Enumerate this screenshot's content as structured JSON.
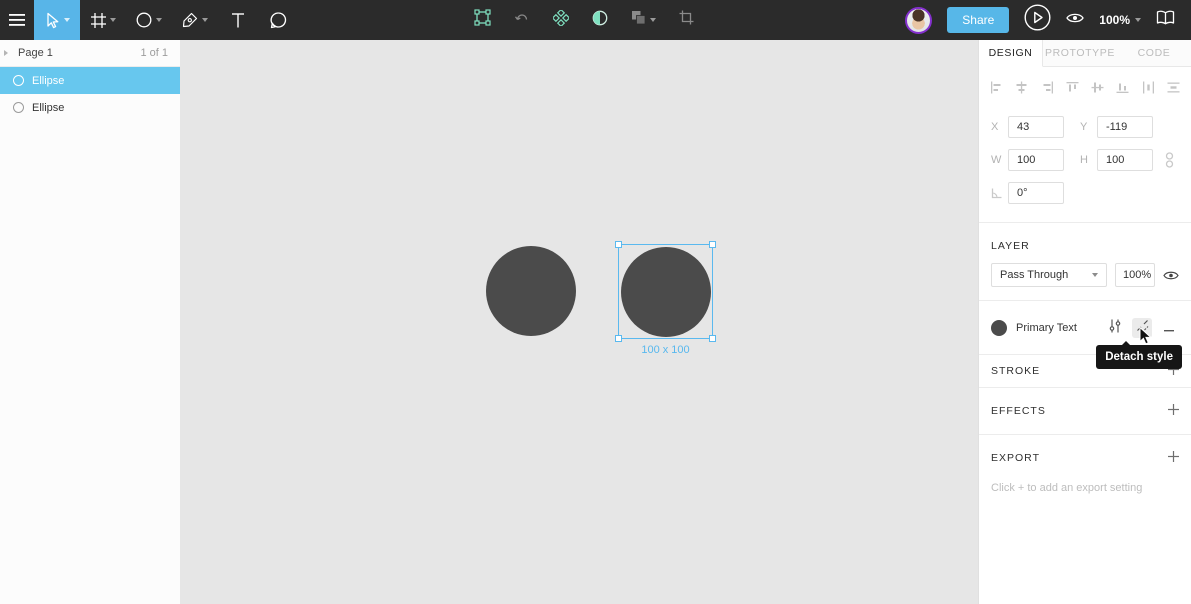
{
  "colors": {
    "toolbar_bg": "#2b2b2b",
    "accent_blue": "#58b5e8",
    "sidebar_selected_blue": "#67c7ee",
    "selection_blue": "#5ab9ef",
    "shape_fill": "#4b4b4b",
    "mint_icon": "#7fe0c0",
    "avatar_ring_purple": "#8430ce",
    "tooltip_bg": "#161616"
  },
  "toolbar": {
    "share_label": "Share",
    "zoom_level": "100%"
  },
  "sidebar": {
    "page_label": "Page 1",
    "page_count": "1 of 1",
    "layers": [
      {
        "name": "Ellipse",
        "selected": true
      },
      {
        "name": "Ellipse",
        "selected": false
      }
    ]
  },
  "canvas": {
    "selection_size_label": "100 x 100"
  },
  "inspector": {
    "tabs": [
      {
        "label": "DESIGN",
        "active": true
      },
      {
        "label": "PROTOTYPE",
        "active": false
      },
      {
        "label": "CODE",
        "active": false
      }
    ],
    "position": {
      "x_label": "X",
      "x_value": "43",
      "y_label": "Y",
      "y_value": "-119",
      "w_label": "W",
      "w_value": "100",
      "h_label": "H",
      "h_value": "100",
      "rotation_value": "0°"
    },
    "layer_section": {
      "title": "LAYER",
      "blend_mode": "Pass Through",
      "opacity": "100%"
    },
    "fill_style": {
      "name": "Primary Text"
    },
    "tooltip": "Detach style",
    "stroke_section": {
      "title": "STROKE"
    },
    "effects_section": {
      "title": "EFFECTS"
    },
    "export_section": {
      "title": "EXPORT",
      "hint": "Click + to add an export setting"
    }
  },
  "icons": [
    "menu-icon",
    "move-tool-icon",
    "frame-tool-icon",
    "ellipse-tool-icon",
    "pen-tool-icon",
    "text-tool-icon",
    "comment-tool-icon",
    "edit-object-icon",
    "reset-instance-icon",
    "component-icon",
    "mask-icon",
    "boolean-group-icon",
    "crop-icon",
    "play-icon",
    "eye-icon",
    "book-icon",
    "align-left-icon",
    "align-h-center-icon",
    "align-right-icon",
    "align-top-icon",
    "align-v-center-icon",
    "align-bottom-icon",
    "distribute-h-icon",
    "distribute-v-icon",
    "constrain-proportions-icon",
    "rotation-icon",
    "chevron-down-icon",
    "sliders-icon",
    "detach-style-icon",
    "minus-icon",
    "plus-icon",
    "ellipse-layer-icon",
    "mouse-cursor"
  ]
}
